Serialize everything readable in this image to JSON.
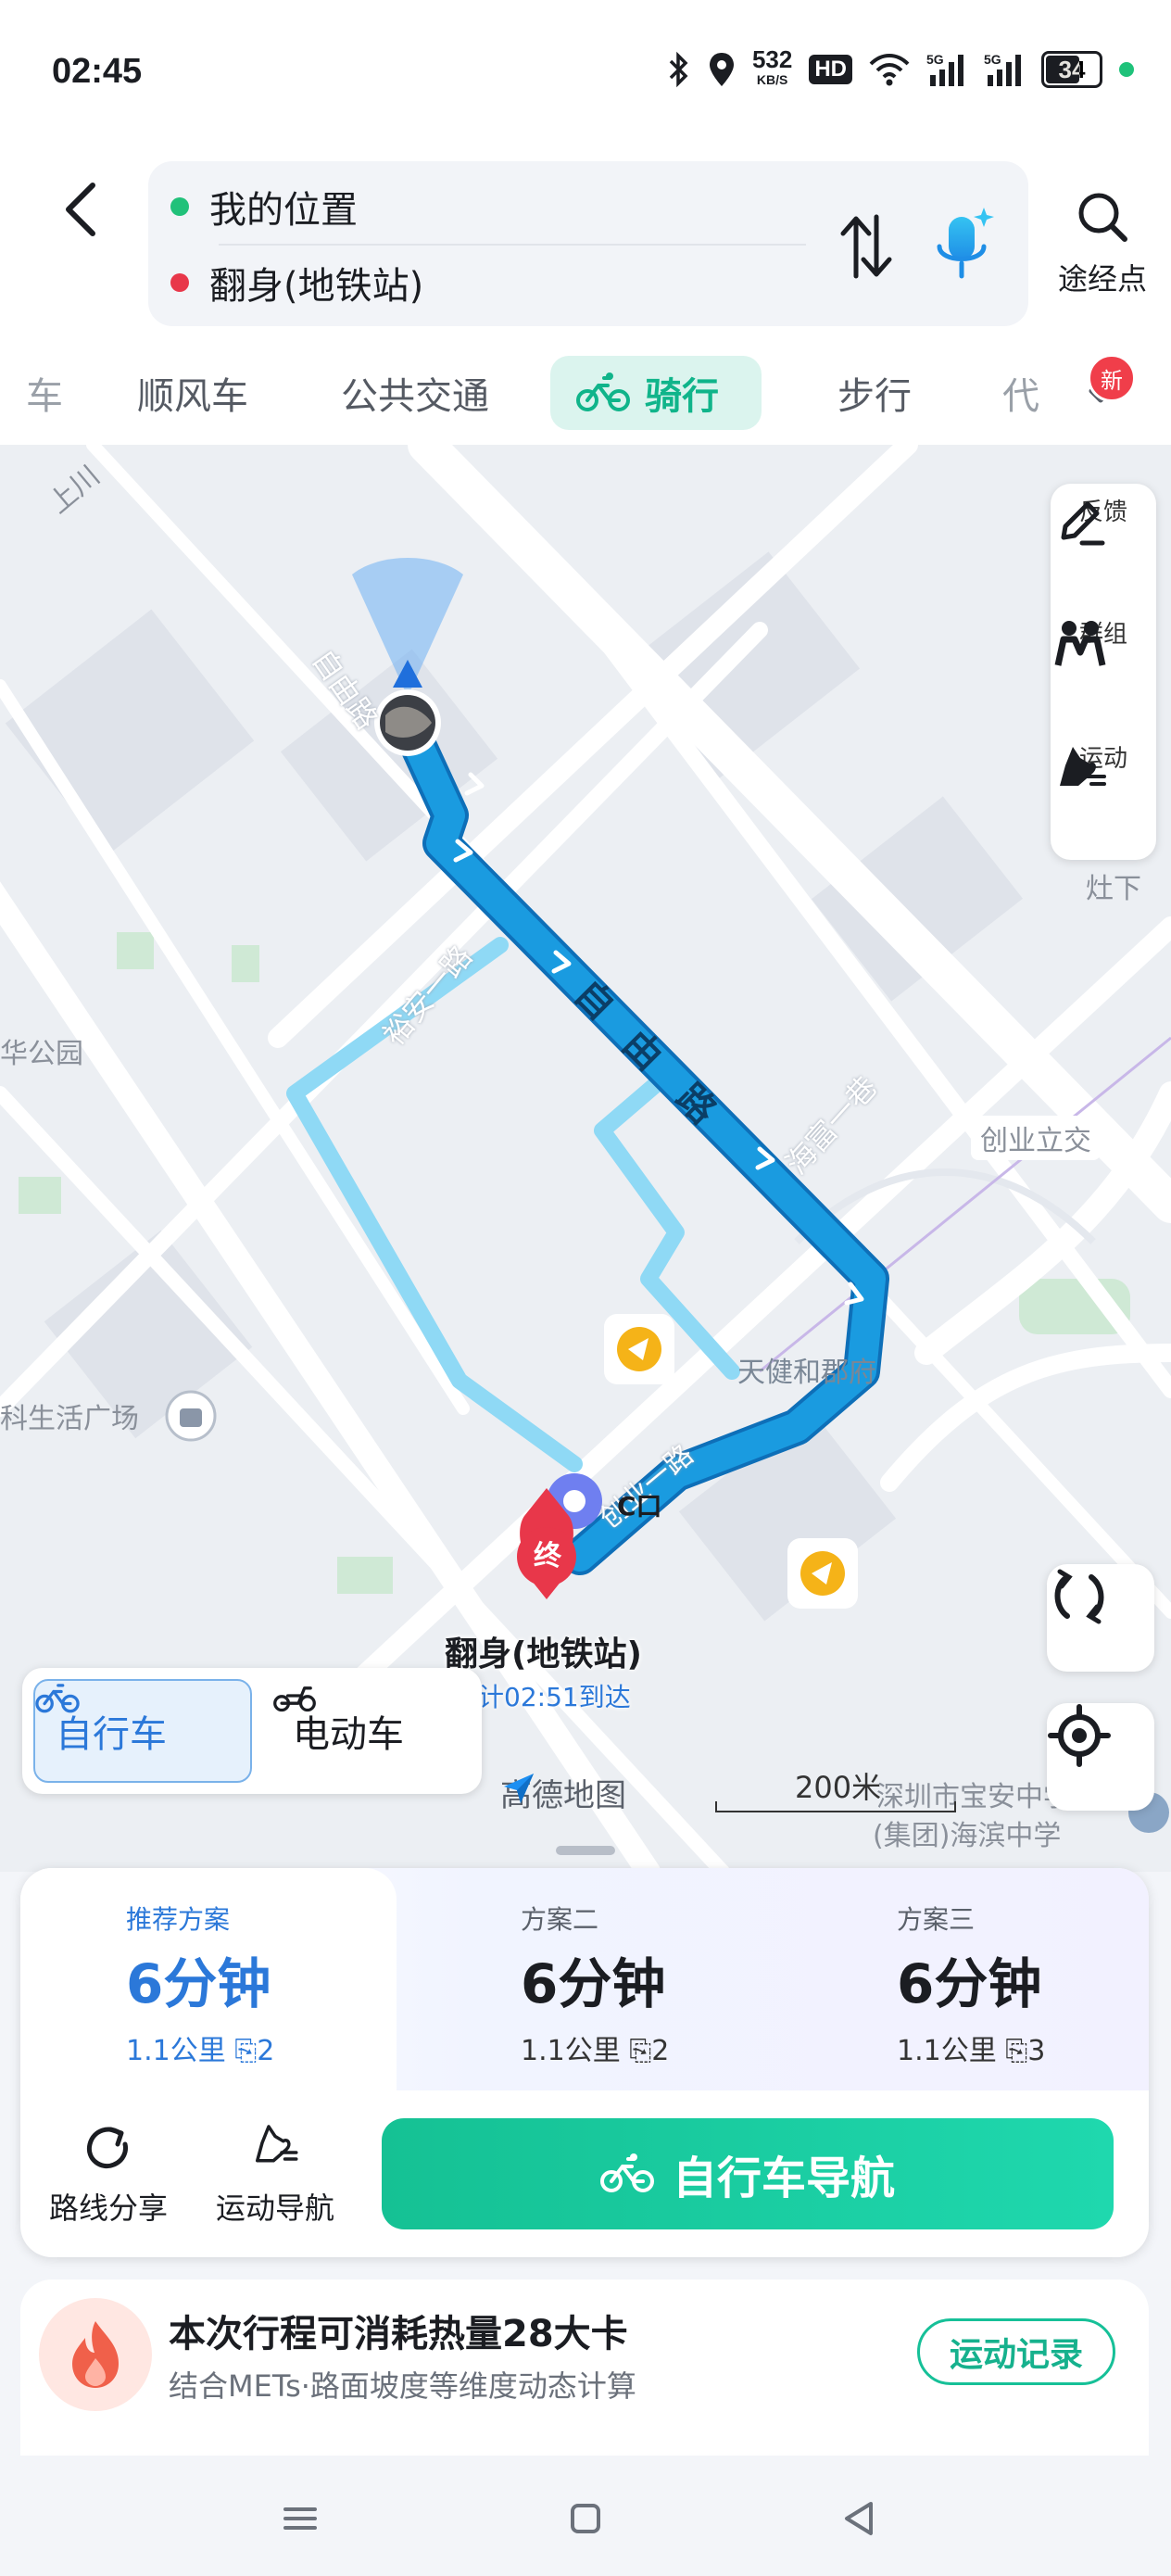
{
  "status_bar": {
    "time": "02:45",
    "speed_value": "532",
    "speed_unit": "KB/S",
    "hd": "HD",
    "battery": "34",
    "icons": [
      "bluetooth-icon",
      "location-icon",
      "wifi-icon",
      "signal-5g-icon",
      "signal-5g-icon",
      "battery-icon"
    ]
  },
  "search": {
    "from": "我的位置",
    "to": "翻身(地铁站)",
    "waypoint_label": "途经点"
  },
  "modes": [
    {
      "label": "车"
    },
    {
      "label": "顺风车"
    },
    {
      "label": "公共交通"
    },
    {
      "label": "骑行",
      "active": true
    },
    {
      "label": "步行"
    },
    {
      "label": "代"
    }
  ],
  "modes_badge": "新",
  "map": {
    "place_labels": [
      "上川",
      "华公园",
      "科生活广场",
      "灶下",
      "创业立交",
      "天健和郡府",
      "深圳市宝安中学",
      "(集团)海滨中学"
    ],
    "road_labels": [
      "自由路",
      "裕安一路",
      "海富一巷",
      "自",
      "由",
      "路",
      "创业一路",
      "C口"
    ],
    "tools": [
      {
        "label": "反馈",
        "icon": "feedback-pencil-icon"
      },
      {
        "label": "群组",
        "icon": "group-icon"
      },
      {
        "label": "运动",
        "icon": "sport-icon"
      }
    ],
    "destination_marker": "终",
    "destination_name": "翻身(地铁站)",
    "eta": "预计02:51到达",
    "brand": "高德地图",
    "scale": "200米"
  },
  "vehicle_toggle": {
    "bike": "自行车",
    "ebike": "电动车"
  },
  "plans": [
    {
      "name": "推荐方案",
      "time": "6分钟",
      "distance": "1.1公里",
      "lights": "2",
      "active": true
    },
    {
      "name": "方案二",
      "time": "6分钟",
      "distance": "1.1公里",
      "lights": "2"
    },
    {
      "name": "方案三",
      "time": "6分钟",
      "distance": "1.1公里",
      "lights": "3"
    }
  ],
  "actions": {
    "share": "路线分享",
    "sport_nav": "运动导航",
    "bike_nav": "自行车导航"
  },
  "calorie": {
    "title": "本次行程可消耗热量28大卡",
    "subtitle": "结合METs·路面坡度等维度动态计算",
    "record_button": "运动记录"
  },
  "colors": {
    "accent_green": "#15c194",
    "route_blue": "#1a9be0",
    "alt_route": "#8fd9f5",
    "plan_blue": "#2b78d9",
    "dest_red": "#e8374a"
  }
}
